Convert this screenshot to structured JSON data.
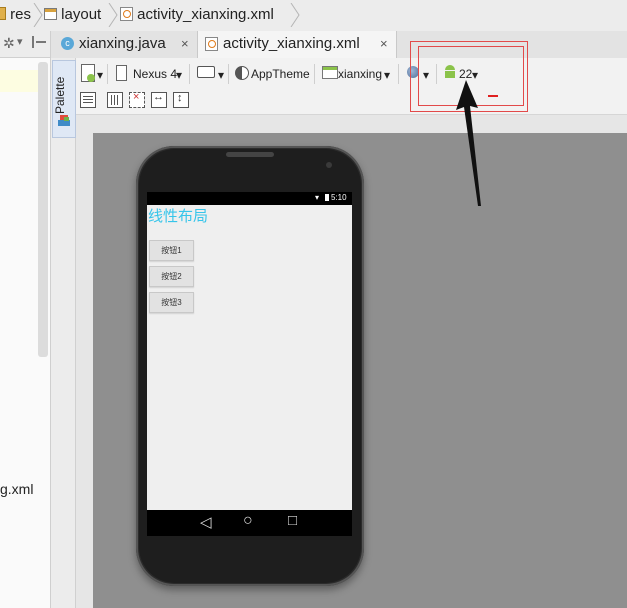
{
  "breadcrumb": {
    "items": [
      {
        "label": "res",
        "icon": "folder-icon"
      },
      {
        "label": "layout",
        "icon": "folder-icon"
      },
      {
        "label": "activity_xianxing.xml",
        "icon": "xml-file-icon"
      }
    ]
  },
  "left_panel": {
    "file_fragment": "g.xml"
  },
  "tabs": [
    {
      "label": "xianxing.java",
      "icon": "java-class-icon",
      "close": "×",
      "active": false
    },
    {
      "label": "activity_xianxing.xml",
      "icon": "xml-file-icon",
      "close": "×",
      "active": true
    }
  ],
  "palette": {
    "label": "Palette"
  },
  "designer_toolbar": {
    "device": "Nexus 4",
    "theme": "AppTheme",
    "activity": "xianxing",
    "api_level": "22",
    "dropdown_glyph": "▾"
  },
  "phone": {
    "time": "5:10",
    "app_title": "线性布局",
    "buttons": [
      "按钮1",
      "按钮2",
      "按钮3"
    ],
    "nav": {
      "back": "◁",
      "home": "○",
      "recents": "□"
    }
  },
  "colors": {
    "accent_title": "#37c5ea",
    "annotation": "#e24a4a",
    "android_green": "#8bc34a"
  }
}
